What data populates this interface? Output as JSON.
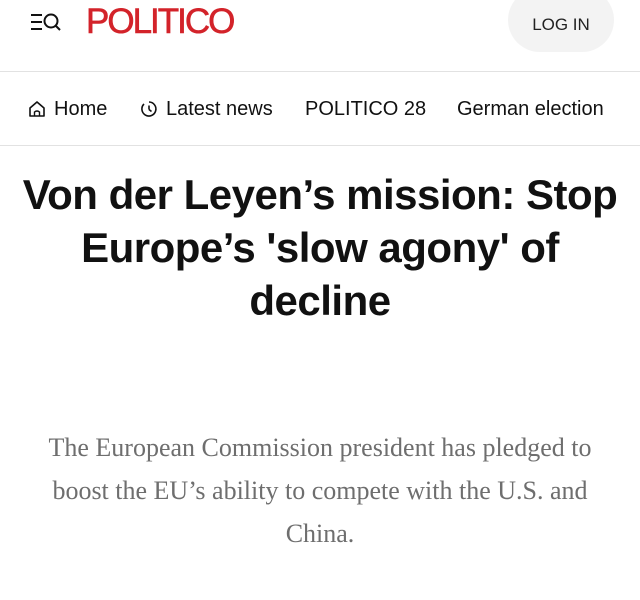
{
  "header": {
    "logo": "POLITICO",
    "login_label": "LOG IN",
    "menu_icon": "menu-search-icon",
    "brand_color": "#d3232a"
  },
  "nav": {
    "items": [
      {
        "label": "Home",
        "icon": "home-icon"
      },
      {
        "label": "Latest news",
        "icon": "clock-icon"
      },
      {
        "label": "POLITICO 28"
      },
      {
        "label": "German election"
      }
    ]
  },
  "article": {
    "headline": "Von der Leyen’s mission: Stop Europe’s 'slow agony' of decline",
    "dek": "The European Commission president has pledged to boost the EU’s ability to compete with the U.S. and China."
  }
}
